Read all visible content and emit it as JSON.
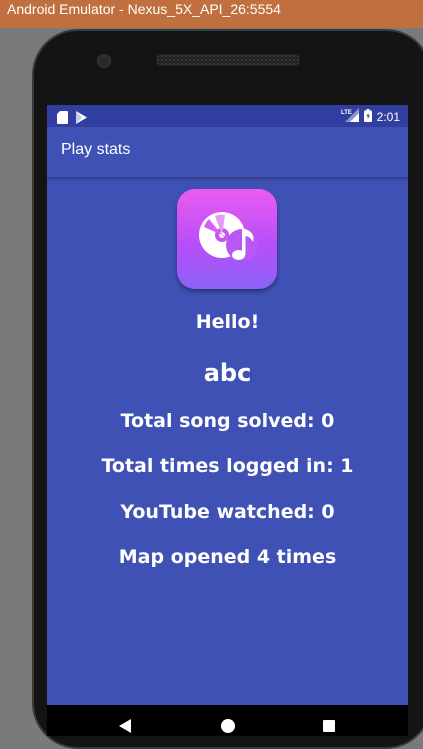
{
  "emulator": {
    "title": "Android Emulator - Nexus_5X_API_26:5554"
  },
  "status_bar": {
    "time": "2:01",
    "network_label": "LTE"
  },
  "app_bar": {
    "title": "Play stats"
  },
  "profile": {
    "greeting": "Hello!",
    "username": "abc"
  },
  "stats": {
    "songs_solved": "Total song solved: 0",
    "times_logged_in": "Total times logged in: 1",
    "youtube_watched": "YouTube watched: 0",
    "map_opened": "Map opened 4 times"
  },
  "icons": {
    "app_icon": "music-disc-icon",
    "status_left": [
      "sd-card-icon",
      "play-store-icon"
    ],
    "status_right": [
      "lte-signal-icon",
      "battery-icon"
    ],
    "nav": [
      "back-icon",
      "home-icon",
      "recents-icon"
    ]
  },
  "colors": {
    "primary": "#3f51b5",
    "primary_dark": "#303f9f",
    "emulator_titlebar": "#c0703e",
    "icon_gradient_top": "#ea5cf0",
    "icon_gradient_bottom": "#8a63f6"
  }
}
